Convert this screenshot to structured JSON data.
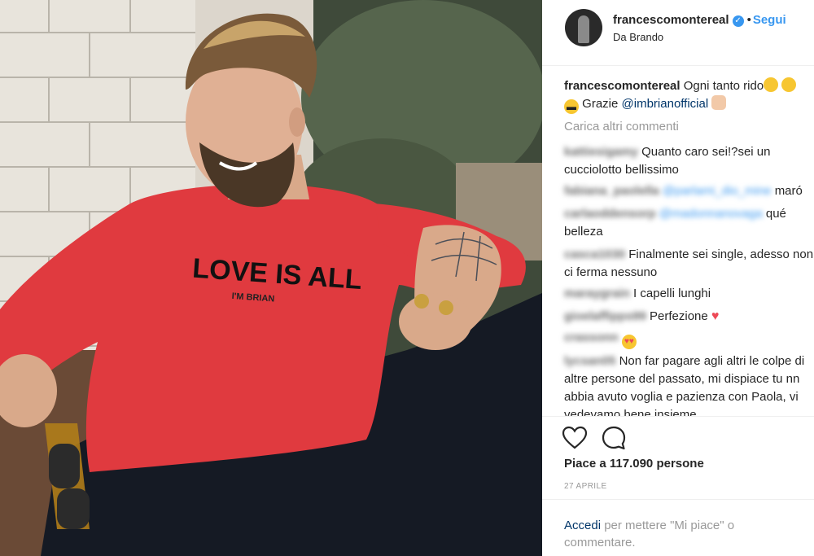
{
  "post": {
    "username": "francescomontereal",
    "follow_label": "Segui",
    "separator": "•",
    "location": "Da Brando",
    "verified_mark": "✓"
  },
  "photo": {
    "sweater_text": "LOVE IS ALL",
    "sweater_subtext": "I'M BRIAN"
  },
  "caption": {
    "username": "francescomontereal",
    "text_1": "Ogni tanto rido",
    "text_2": "Grazie",
    "mention": "@imbrianofficial"
  },
  "load_more": "Carica altri commenti",
  "comments": [
    {
      "user": "kattiesigamy",
      "text": "Quanto caro sei!?sei un cucciolotto bellissimo"
    },
    {
      "user": "fabiana_paolella",
      "mention": "@parlami_dio_mine",
      "text": "maró"
    },
    {
      "user": "carlaoddensorp",
      "mention": "@madonnanovaga",
      "text": "qué belleza"
    },
    {
      "user": "casca1030",
      "text": "Finalmente sei single, adesso non ci ferma nessuno"
    },
    {
      "user": "maraygrain",
      "text": "I capelli lunghi"
    },
    {
      "user": "gioelaffipps99",
      "text": "Perfezione"
    },
    {
      "user": "crassonn",
      "text": ""
    },
    {
      "user": "lycsan05",
      "text": "Non far pagare agli altri le colpe di altre persone del passato, mi dispiace tu nn abbia avuto voglia e pazienza con Paola, vi vedevamo bene insieme"
    }
  ],
  "actions": {
    "likes": "Piace a 117.090 persone",
    "date": "27 APRILE"
  },
  "login": {
    "link": "Accedi",
    "text": "per mettere \"Mi piace\" o commentare."
  },
  "colors": {
    "link_blue": "#3897f0",
    "mention_navy": "#003569",
    "muted_gray": "#999999",
    "sweater_red": "#e03a3f",
    "heart_red": "#ed4956"
  },
  "icons": [
    "verified-icon",
    "heart-icon",
    "comment-icon",
    "heart-emoji-icon",
    "sunglasses-emoji-icon",
    "face-emoji-icon"
  ]
}
